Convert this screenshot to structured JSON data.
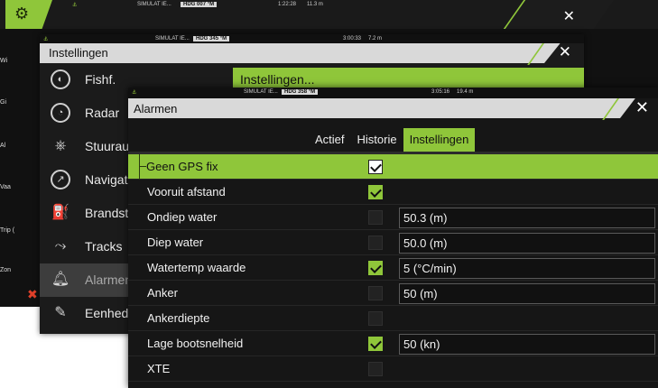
{
  "back_window": {
    "status": {
      "hdg_label": "HDG",
      "hdg_value": "007 °M",
      "sim": "SIMULAT IE...",
      "time": "1:22:28",
      "dist": "11.3 m"
    },
    "side_labels": [
      "Wi",
      "Gi",
      "Al",
      "Vaa",
      "Trip (",
      "Zon"
    ],
    "close_label": "✕"
  },
  "mid_window": {
    "status": {
      "hdg_label": "HDG",
      "hdg_value": "345 °M",
      "sim": "SIMULAT IE...",
      "time": "3:00:33",
      "dist": "7.2 m"
    },
    "title": "Instellingen",
    "close_label": "✕",
    "content_header": "Instellingen...",
    "menu": [
      {
        "label": "Fishf.",
        "icon": "fish-icon"
      },
      {
        "label": "Radar",
        "icon": "radar-icon"
      },
      {
        "label": "Stuuraut",
        "icon": "steering-wheel-icon"
      },
      {
        "label": "Navigatio",
        "icon": "compass-icon"
      },
      {
        "label": "Brandsto",
        "icon": "fuel-icon"
      },
      {
        "label": "Tracks",
        "icon": "tracks-icon"
      },
      {
        "label": "Alarmen",
        "icon": "bell-icon"
      },
      {
        "label": "Eenhede",
        "icon": "pencil-icon"
      }
    ]
  },
  "front_window": {
    "status": {
      "hdg_label": "HDG",
      "hdg_value": "358 °M",
      "sim": "SIMULAT IE...",
      "time": "3:05:16",
      "dist": "19.4 m"
    },
    "title": "Alarmen",
    "close_label": "✕",
    "tabs": [
      "Actief",
      "Historie",
      "Instellingen"
    ],
    "active_tab": "Instellingen",
    "rows": [
      {
        "name": "Geen GPS fix",
        "checked": true,
        "value": null
      },
      {
        "name": "Vooruit afstand",
        "checked": true,
        "value": null
      },
      {
        "name": "Ondiep water",
        "checked": false,
        "value": "50.3 (m)"
      },
      {
        "name": "Diep water",
        "checked": false,
        "value": "50.0 (m)"
      },
      {
        "name": "Watertemp waarde",
        "checked": true,
        "value": "5 (°C/min)"
      },
      {
        "name": "Anker",
        "checked": false,
        "value": "50 (m)"
      },
      {
        "name": "Ankerdiepte",
        "checked": false,
        "value": null
      },
      {
        "name": "Lage bootsnelheid",
        "checked": true,
        "value": "50 (kn)"
      },
      {
        "name": "XTE",
        "checked": false,
        "value": null
      }
    ]
  },
  "colors": {
    "accent": "#8fc63a",
    "panel": "#161616",
    "header": "#d9d9d9"
  }
}
